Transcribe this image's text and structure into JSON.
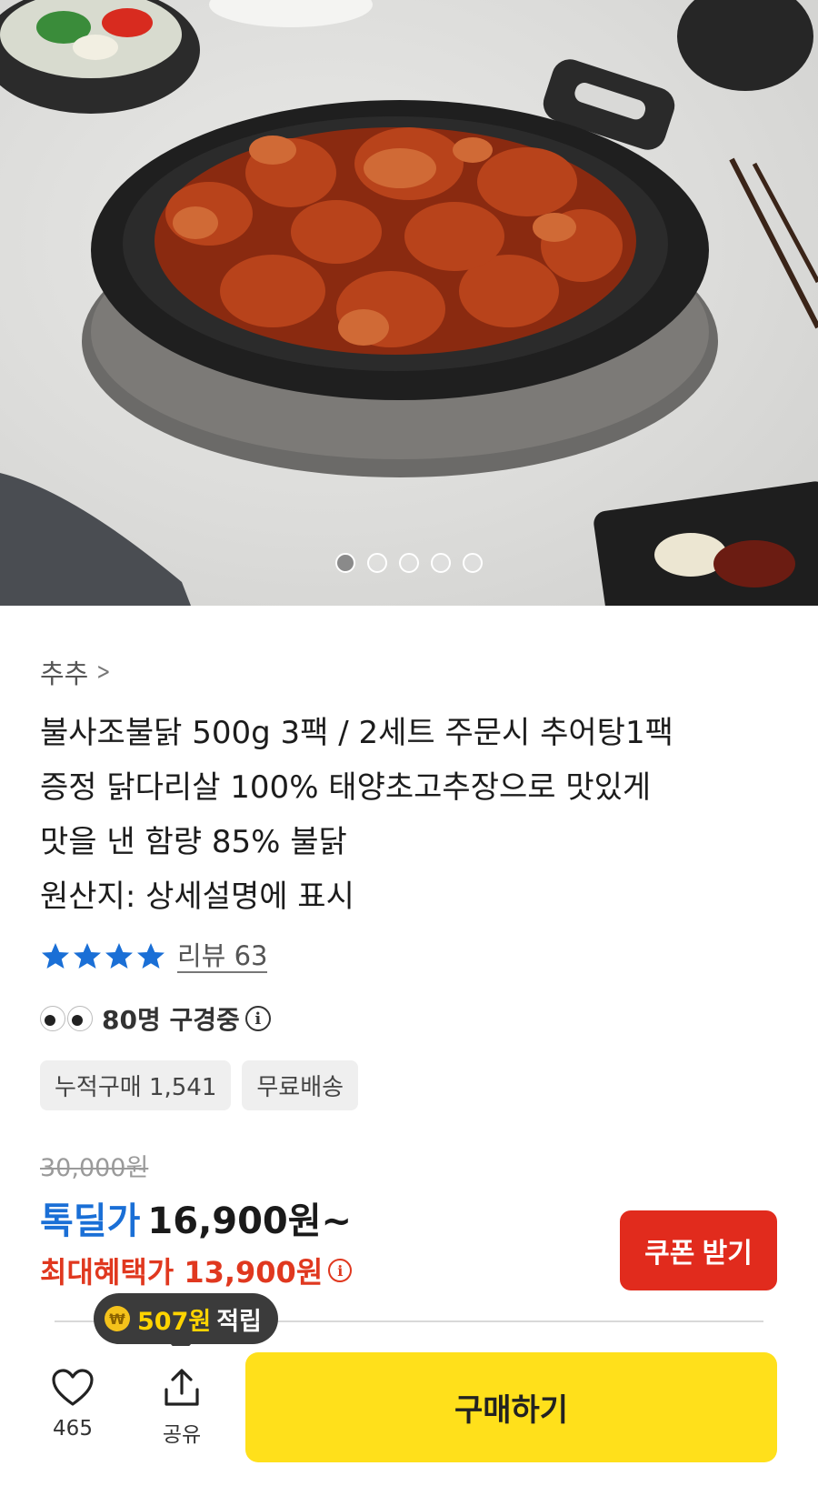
{
  "carousel": {
    "total": 5,
    "active": 0
  },
  "product": {
    "seller": "추추",
    "title_lines": [
      "불사조불닭 500g 3팩 / 2세트 주문시 추어탕1팩",
      "증정 닭다리살 100% 태양초고추장으로 맛있게",
      "맛을 낸 함량 85% 불닭",
      "원산지: 상세설명에 표시"
    ],
    "rating_stars": 4,
    "review_label": "리뷰 63",
    "viewers_text": "80명 구경중",
    "chips": [
      "누적구매 1,541",
      "무료배송"
    ],
    "original_price": "30,000원",
    "deal_label": "톡딜가",
    "deal_price": "16,900원~",
    "max_benefit": "최대혜택가 13,900원",
    "coupon_button": "쿠폰 받기",
    "points_amount": "507원",
    "points_text": "적립"
  },
  "bottom_bar": {
    "like_count": "465",
    "share_label": "공유",
    "buy_button": "구매하기"
  },
  "colors": {
    "deal_blue": "#1a6fd6",
    "benefit_red": "#e0381f",
    "coupon_red": "#e12b1d",
    "buy_yellow": "#ffe01b",
    "star_blue": "#1a6fd6"
  }
}
